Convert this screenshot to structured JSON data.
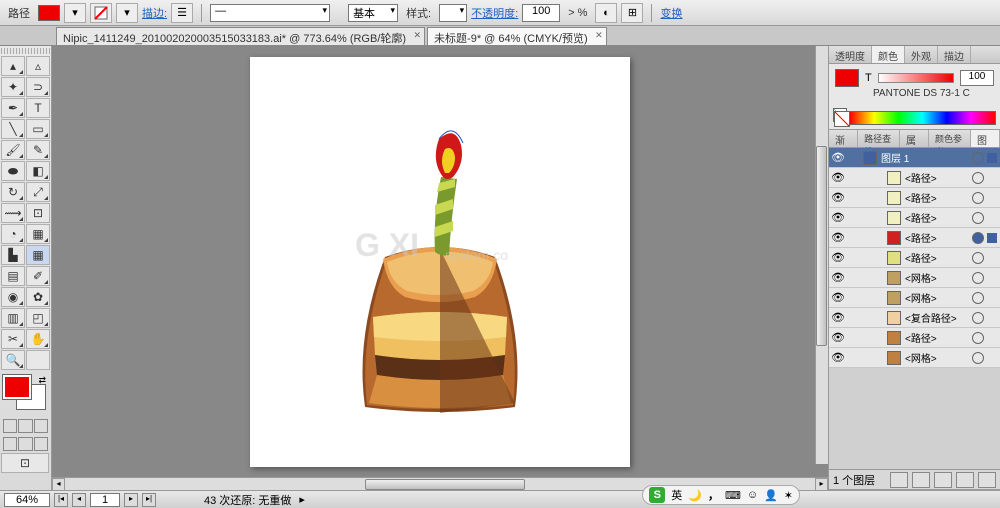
{
  "toolbar": {
    "path_label": "路径",
    "stroke_label": "描边:",
    "basic_label": "基本",
    "style_label": "样式:",
    "opacity_label": "不透明度:",
    "opacity_value": "100",
    "opacity_unit": "> %",
    "transform_link": "变换",
    "fill_color": "#e00000"
  },
  "tabs": [
    {
      "label": "Nipic_1411249_201002020003515033183.ai* @ 773.64% (RGB/轮廓)",
      "active": false
    },
    {
      "label": "未标题-9* @ 64% (CMYK/预览)",
      "active": true
    }
  ],
  "color_panel": {
    "tabs": [
      "透明度",
      "颜色",
      "外观",
      "描边"
    ],
    "active_tab": 1,
    "tint_label": "T",
    "tint_value": "100",
    "swatch_name": "PANTONE DS 73-1 C",
    "fill_color": "#e00000"
  },
  "layers_panel": {
    "tabs": [
      "渐变",
      "路径查找",
      "属性",
      "颜色参考",
      "图层"
    ],
    "active_tab": 4,
    "layers": [
      {
        "name": "图层 1",
        "color": "#4060a0",
        "selected": true,
        "thumb": "#4060a0"
      },
      {
        "name": "<路径>",
        "color": "#f0f0c0",
        "thumb": "#f0f0c0"
      },
      {
        "name": "<路径>",
        "color": "#f0f0c0",
        "thumb": "#f0f0c0"
      },
      {
        "name": "<路径>",
        "color": "#f0f0c0",
        "thumb": "#f0f0c0"
      },
      {
        "name": "<路径>",
        "color": "#d02020",
        "thumb": "#d02020",
        "target_filled": true
      },
      {
        "name": "<路径>",
        "color": "#e0e080",
        "thumb": "#e0e080"
      },
      {
        "name": "<网格>",
        "color": "#c0a060",
        "thumb": "#c0a060"
      },
      {
        "name": "<网格>",
        "color": "#c0a060",
        "thumb": "#c0a060"
      },
      {
        "name": "<复合路径>",
        "color": "#f0d0a0",
        "thumb": "#f0d0a0"
      },
      {
        "name": "<路径>",
        "color": "#c08040",
        "thumb": "#c08040"
      },
      {
        "name": "<网格>",
        "color": "#c08040",
        "thumb": "#c08040"
      }
    ],
    "footer_text": "1 个图层"
  },
  "status": {
    "zoom": "64%",
    "page": "1",
    "undo_text": "43 次还原: 无重做"
  },
  "ime": {
    "lang": "英"
  },
  "watermark": {
    "a": "G XI",
    "b": "system.co"
  }
}
